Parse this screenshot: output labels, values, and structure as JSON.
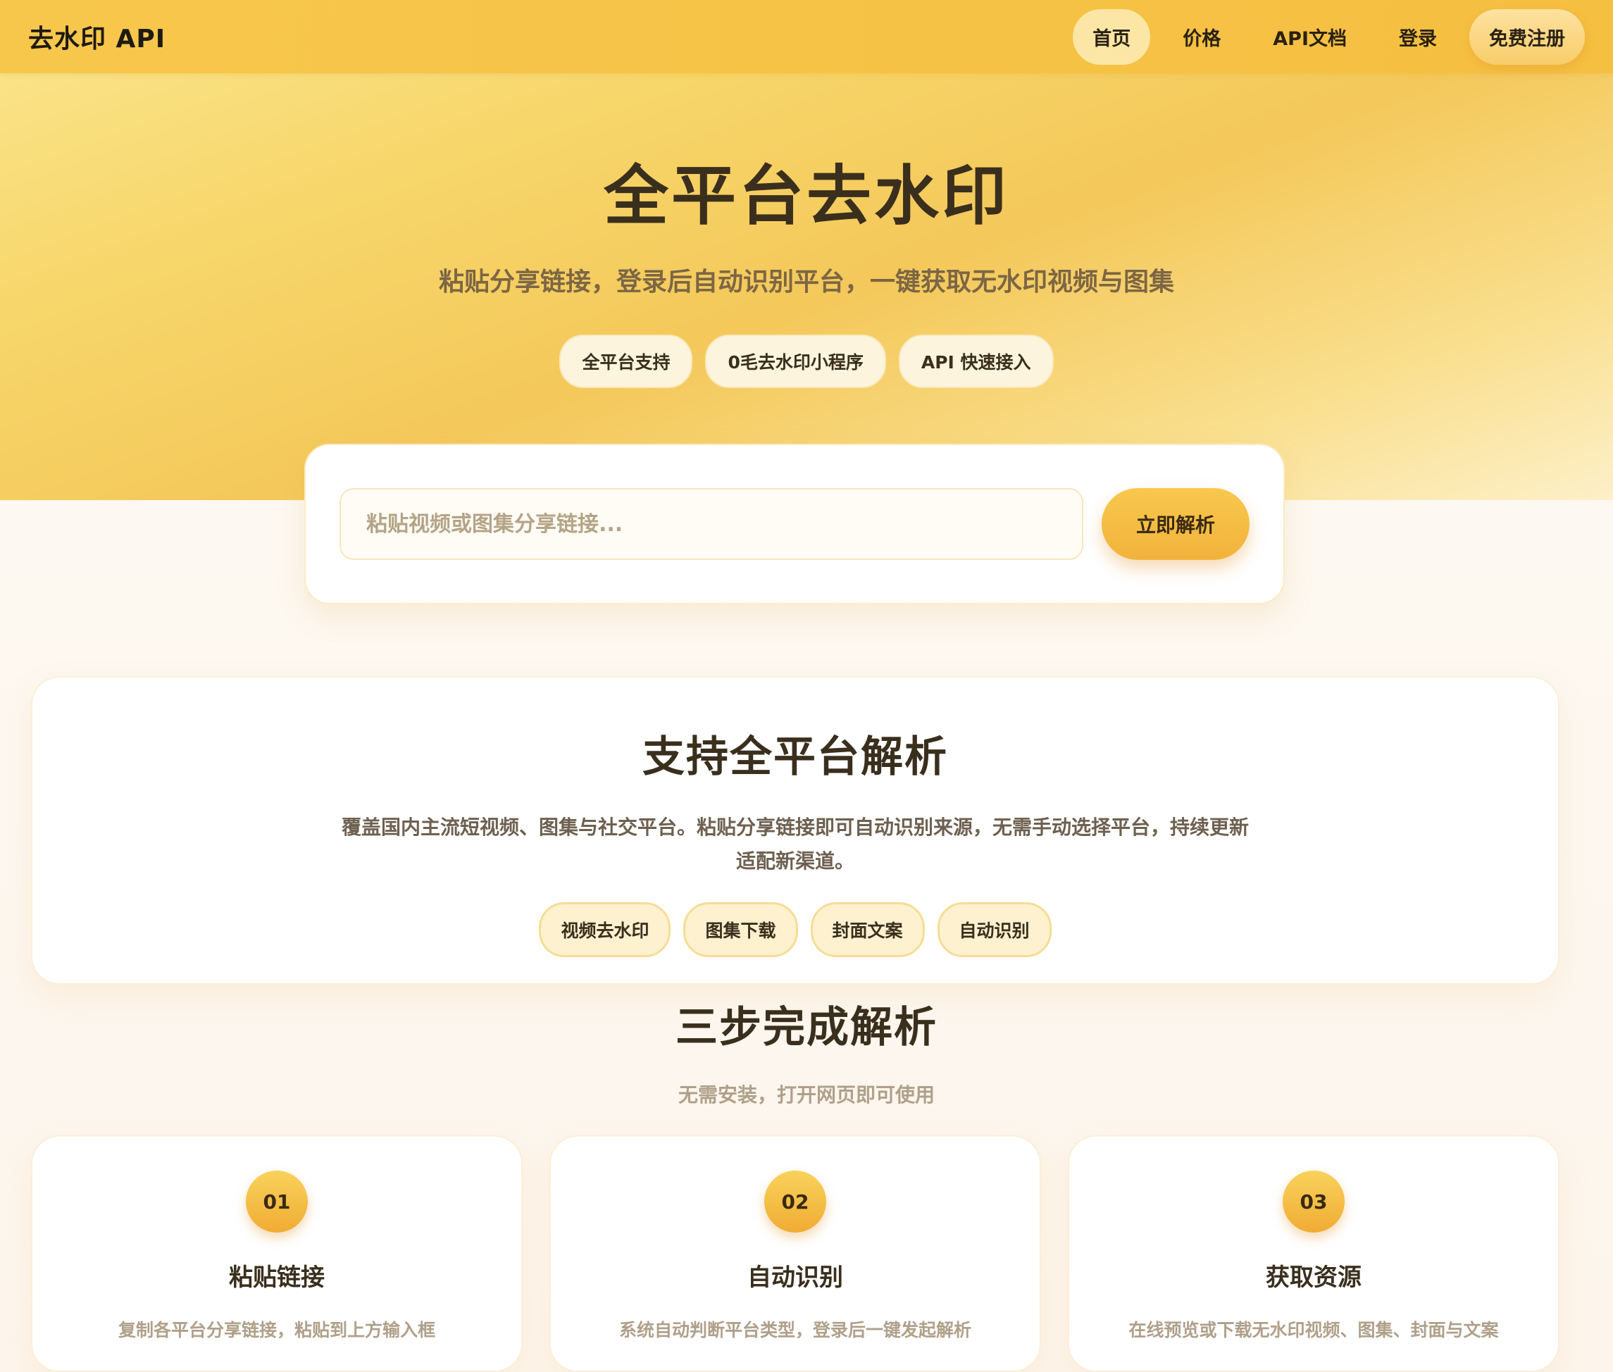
{
  "nav": {
    "brand": "去水印 API",
    "links": [
      {
        "label": "首页"
      },
      {
        "label": "价格"
      },
      {
        "label": "API文档"
      },
      {
        "label": "登录"
      },
      {
        "label": "免费注册"
      }
    ]
  },
  "hero": {
    "title": "全平台去水印",
    "subtitle": "粘贴分享链接，登录后自动识别平台，一键获取无水印视频与图集",
    "tags": [
      "全平台支持",
      "0毛去水印小程序",
      "API 快速接入"
    ]
  },
  "search": {
    "placeholder": "粘贴视频或图集分享链接...",
    "button_label": "立即解析"
  },
  "platforms": {
    "title": "支持全平台解析",
    "description": "覆盖国内主流短视频、图集与社交平台。粘贴分享链接即可自动识别来源，无需手动选择平台，持续更新适配新渠道。",
    "tags": [
      "视频去水印",
      "图集下载",
      "封面文案",
      "自动识别"
    ]
  },
  "steps": {
    "title": "三步完成解析",
    "subtitle": "无需安装，打开网页即可使用",
    "items": [
      {
        "num": "01",
        "title": "粘贴链接",
        "desc": "复制各平台分享链接，粘贴到上方输入框"
      },
      {
        "num": "02",
        "title": "自动识别",
        "desc": "系统自动判断平台类型，登录后一键发起解析"
      },
      {
        "num": "03",
        "title": "获取资源",
        "desc": "在线预览或下载无水印视频、图集、封面与文案"
      }
    ]
  },
  "colors": {
    "accent": "#f5bf41",
    "accent_light": "#fbe6a6",
    "text_dark": "#3a2f1d"
  }
}
